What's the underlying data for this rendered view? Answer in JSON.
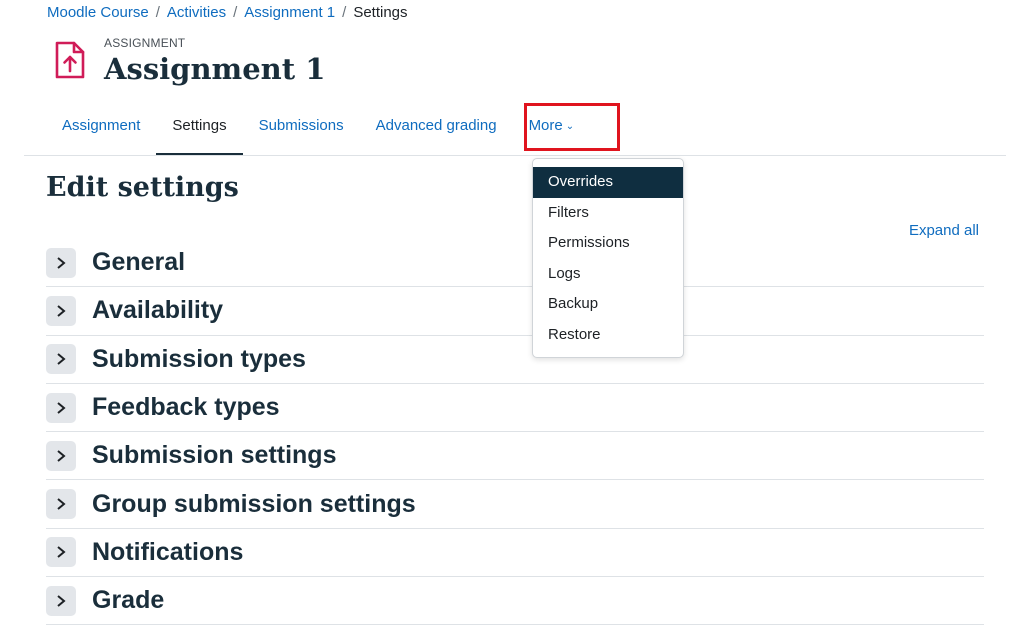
{
  "breadcrumb": {
    "items": [
      "Moodle Course",
      "Activities",
      "Assignment 1"
    ],
    "current": "Settings",
    "separator": "/"
  },
  "header": {
    "activity_type": "ASSIGNMENT",
    "title": "Assignment 1",
    "icon": "file-upload-icon",
    "icon_color": "#d01c58"
  },
  "nav": {
    "tabs": [
      {
        "label": "Assignment",
        "active": false
      },
      {
        "label": "Settings",
        "active": true
      },
      {
        "label": "Submissions",
        "active": false
      },
      {
        "label": "Advanced grading",
        "active": false
      },
      {
        "label": "More",
        "active": false
      }
    ],
    "more_icon": "chevron-down-icon"
  },
  "more_menu": {
    "items": [
      {
        "label": "Overrides",
        "active": true
      },
      {
        "label": "Filters",
        "active": false
      },
      {
        "label": "Permissions",
        "active": false
      },
      {
        "label": "Logs",
        "active": false
      },
      {
        "label": "Backup",
        "active": false
      },
      {
        "label": "Restore",
        "active": false
      }
    ]
  },
  "main": {
    "heading": "Edit settings",
    "expand_all": "Expand all",
    "sections": [
      "General",
      "Availability",
      "Submission types",
      "Feedback types",
      "Submission settings",
      "Group submission settings",
      "Notifications",
      "Grade"
    ]
  },
  "colors": {
    "link": "#0f6cbf",
    "heading": "#1a2e3b",
    "menu_active_bg": "#0f2e40",
    "highlight": "#e0141e"
  }
}
